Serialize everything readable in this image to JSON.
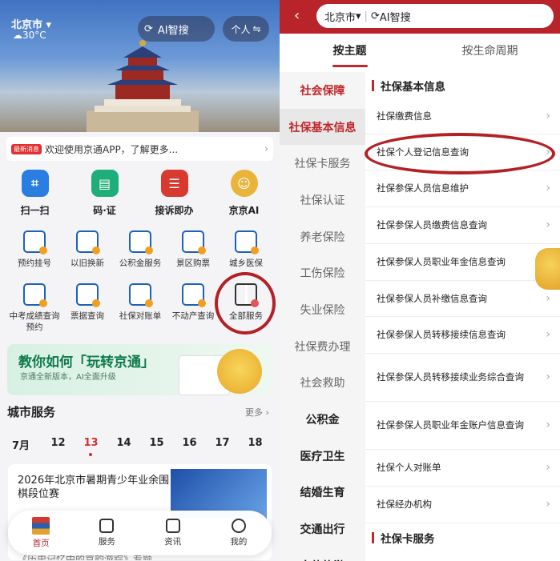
{
  "left": {
    "city": "北京市",
    "weather": "30°C",
    "ai_search": "AI智搜",
    "personal": "个人",
    "news_tag": "最新消息",
    "news_text": "欢迎使用京通APP，了解更多...",
    "big_icons": [
      {
        "label": "扫一扫",
        "icon": "scan-icon",
        "color": "#2a7de1"
      },
      {
        "label": "码·证",
        "icon": "id-card-icon",
        "color": "#1fae7a"
      },
      {
        "label": "接诉即办",
        "icon": "complaint-icon",
        "color": "#d83a30"
      },
      {
        "label": "京京AI",
        "icon": "mascot-icon",
        "color": "#e8b43a"
      }
    ],
    "grid_row1": [
      "预约挂号",
      "以旧换新",
      "公积金服务",
      "景区购票",
      "城乡医保"
    ],
    "grid_row2": [
      "中考成绩查询预约",
      "票据查询",
      "社保对账单",
      "不动产查询",
      "全部服务"
    ],
    "banner_title": "教你如何「玩转京通」",
    "banner_sub": "京通全新版本，AI全面升级",
    "city_services": "城市服务",
    "more": "更多",
    "month": "7月",
    "dates": [
      "12",
      "13",
      "14",
      "15",
      "16",
      "17",
      "18"
    ],
    "active_date": "13",
    "card_title": "2026年北京市暑期青少年业余围棋段位赛",
    "card_sub": "《历史记忆中的京韵游踪》专题",
    "tabs": [
      "首页",
      "服务",
      "资讯",
      "我的"
    ]
  },
  "right": {
    "city": "北京市",
    "ai_search": "AI智搜",
    "top_tabs": [
      "按主题",
      "按生命周期"
    ],
    "categories": [
      "社会保障",
      "社保基本信息",
      "社保卡服务",
      "社保认证",
      "养老保险",
      "工伤保险",
      "失业保险",
      "社保费办理",
      "社会救助",
      "公积金",
      "医疗卫生",
      "结婚生育",
      "交通出行",
      "文体旅游"
    ],
    "section1": "社保基本信息",
    "items": [
      "社保缴费信息",
      "社保个人登记信息查询",
      "社保参保人员信息维护",
      "社保参保人员缴费信息查询",
      "社保参保人员职业年金信息查询",
      "社保参保人员补缴信息查询",
      "社保参保人员转移接续信息查询",
      "社保参保人员转移接续业务综合查询",
      "社保参保人员职业年金账户信息查询",
      "社保个人对账单",
      "社保经办机构"
    ],
    "section2": "社保卡服务"
  }
}
